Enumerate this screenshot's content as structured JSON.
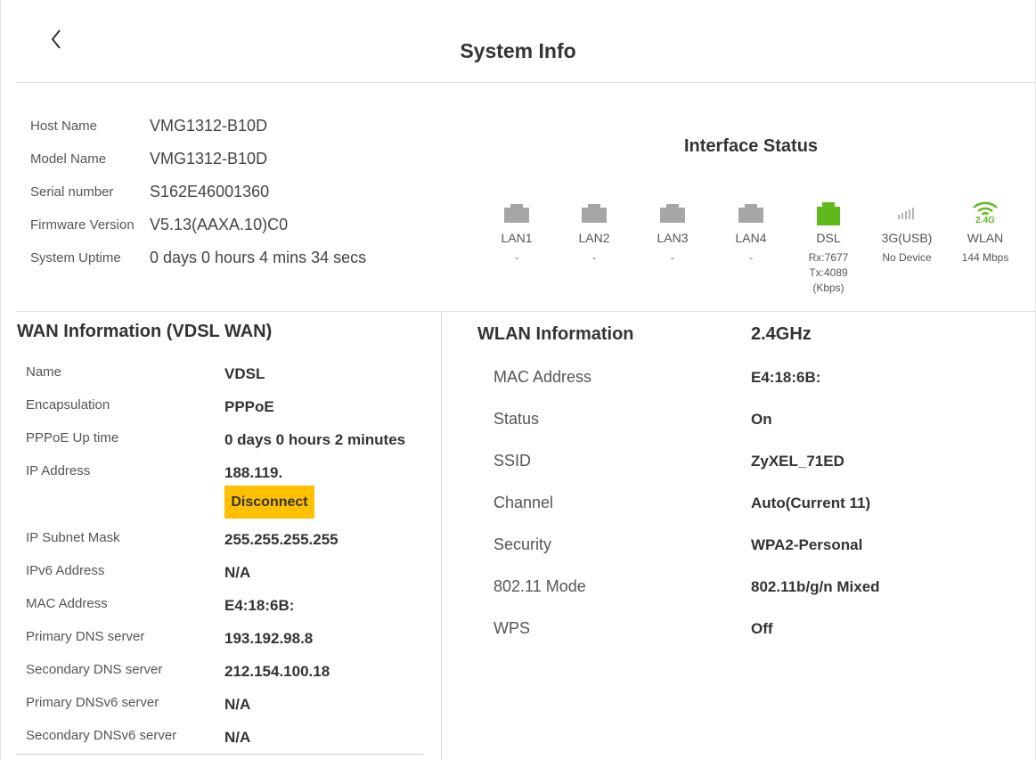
{
  "header": {
    "title": "System Info"
  },
  "system": {
    "rows": [
      {
        "label": "Host Name",
        "value": "VMG1312-B10D"
      },
      {
        "label": "Model Name",
        "value": "VMG1312-B10D"
      },
      {
        "label": "Serial number",
        "value": "S162E46001360"
      },
      {
        "label": "Firmware Version",
        "value": "V5.13(AAXA.10)C0"
      },
      {
        "label": "System Uptime",
        "value": "0 days 0 hours 4 mins 34 secs"
      }
    ]
  },
  "interface_status": {
    "title": "Interface Status",
    "items": [
      {
        "name": "LAN1",
        "detail1": "-",
        "detail2": "",
        "icon": "ethernet-port-icon",
        "color": "#a6a6a6"
      },
      {
        "name": "LAN2",
        "detail1": "-",
        "detail2": "",
        "icon": "ethernet-port-icon",
        "color": "#a6a6a6"
      },
      {
        "name": "LAN3",
        "detail1": "-",
        "detail2": "",
        "icon": "ethernet-port-icon",
        "color": "#a6a6a6"
      },
      {
        "name": "LAN4",
        "detail1": "-",
        "detail2": "",
        "icon": "ethernet-port-icon",
        "color": "#a6a6a6"
      },
      {
        "name": "DSL",
        "detail1": "Rx:7677",
        "detail2": "Tx:4089 (Kbps)",
        "icon": "dsl-port-icon",
        "color": "#5fb81c"
      },
      {
        "name": "3G(USB)",
        "detail1": "No Device",
        "detail2": "",
        "icon": "signal-bars-icon",
        "color": "#b3b3b3"
      },
      {
        "name": "WLAN",
        "detail1": "144 Mbps",
        "detail2": "",
        "icon": "wifi-icon",
        "color": "#5fb81c",
        "badge": "2.4G"
      }
    ]
  },
  "wan": {
    "title": "WAN Information (VDSL WAN)",
    "rows": [
      {
        "label": "Name",
        "value": "VDSL"
      },
      {
        "label": "Encapsulation",
        "value": "PPPoE"
      },
      {
        "label": "PPPoE Up time",
        "value": "0 days 0 hours 2 minutes"
      },
      {
        "label": "IP Address",
        "value": "188.119."
      },
      {
        "label": "IP Subnet Mask",
        "value": "255.255.255.255"
      },
      {
        "label": "IPv6 Address",
        "value": "N/A"
      },
      {
        "label": "MAC Address",
        "value": "E4:18:6B:"
      },
      {
        "label": "Primary DNS server",
        "value": "193.192.98.8"
      },
      {
        "label": "Secondary DNS server",
        "value": "212.154.100.18"
      },
      {
        "label": "Primary DNSv6 server",
        "value": "N/A"
      },
      {
        "label": "Secondary DNSv6 server",
        "value": "N/A"
      }
    ],
    "disconnect_label": "Disconnect",
    "accent": "#ffc000"
  },
  "wlan": {
    "title": "WLAN Information",
    "band": "2.4GHz",
    "rows": [
      {
        "label": "MAC Address",
        "value": "E4:18:6B:"
      },
      {
        "label": "Status",
        "value": "On"
      },
      {
        "label": "SSID",
        "value": "ZyXEL_71ED"
      },
      {
        "label": "Channel",
        "value": "Auto(Current 11)"
      },
      {
        "label": "Security",
        "value": "WPA2-Personal"
      },
      {
        "label": "802.11 Mode",
        "value": "802.11b/g/n Mixed"
      },
      {
        "label": "WPS",
        "value": "Off"
      }
    ]
  }
}
